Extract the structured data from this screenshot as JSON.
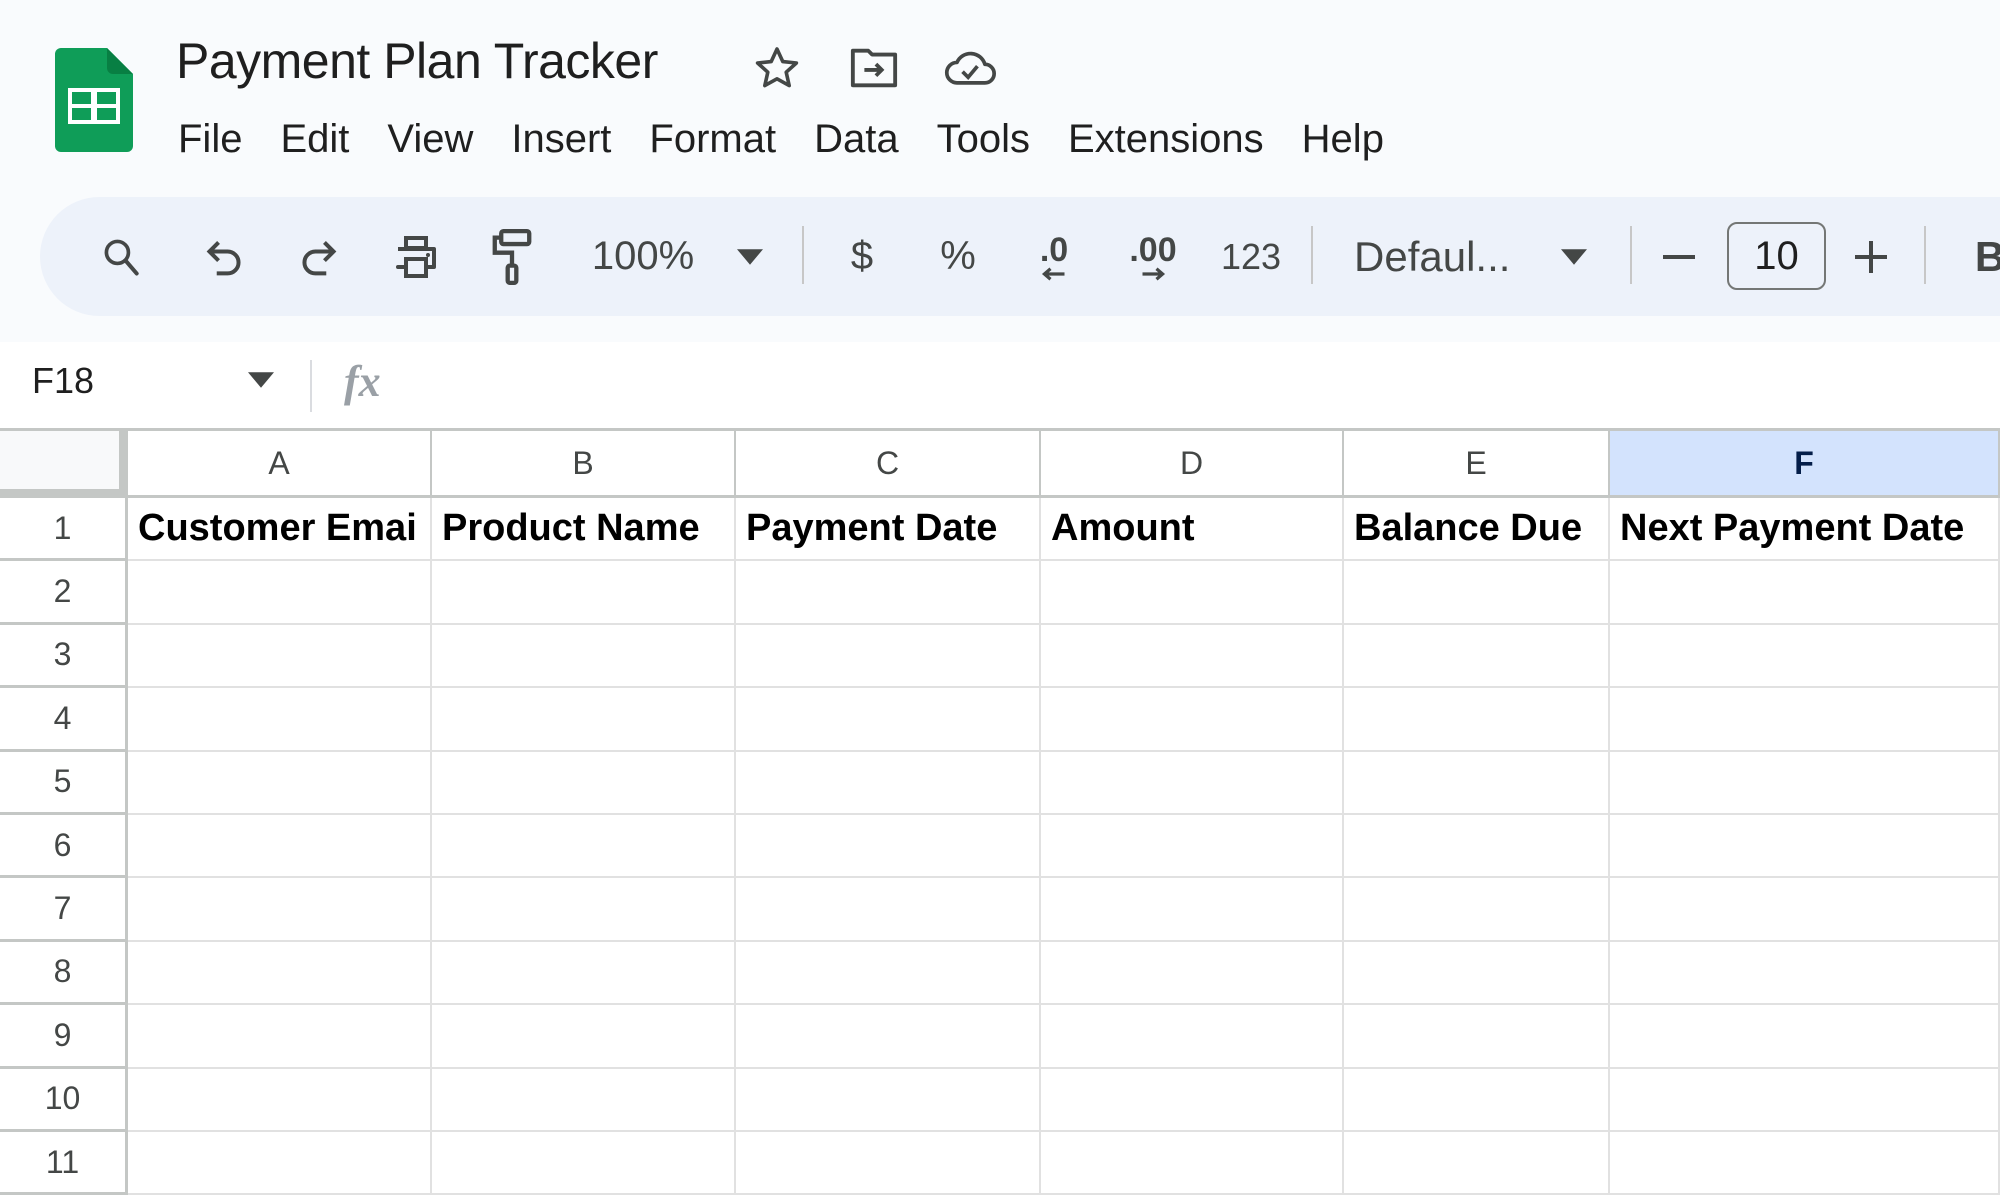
{
  "app": {
    "title": "Payment Plan Tracker",
    "brand_color": "#0f9d58",
    "title_icons": [
      "star-icon",
      "move-to-folder-icon",
      "cloud-saved-icon"
    ]
  },
  "menu": [
    "File",
    "Edit",
    "View",
    "Insert",
    "Format",
    "Data",
    "Tools",
    "Extensions",
    "Help"
  ],
  "toolbar": {
    "zoom": "100%",
    "currency": "$",
    "percent": "%",
    "decrease_decimal": ".0",
    "increase_decimal": ".00",
    "number_format": "123",
    "font_family": "Defaul...",
    "font_size": "10",
    "decrease_font": "−",
    "increase_font": "+",
    "bold": "B"
  },
  "formula_bar": {
    "name_box": "F18",
    "fx_label": "fx",
    "formula": ""
  },
  "sheet": {
    "columns": [
      "A",
      "B",
      "C",
      "D",
      "E",
      "F"
    ],
    "selected_column": "F",
    "rows": [
      "1",
      "2",
      "3",
      "4",
      "5",
      "6",
      "7",
      "8",
      "9",
      "10",
      "11"
    ],
    "header_row": [
      "Customer Emai",
      "Product Name",
      "Payment Date",
      "Amount",
      "Balance Due",
      "Next Payment Date"
    ]
  }
}
